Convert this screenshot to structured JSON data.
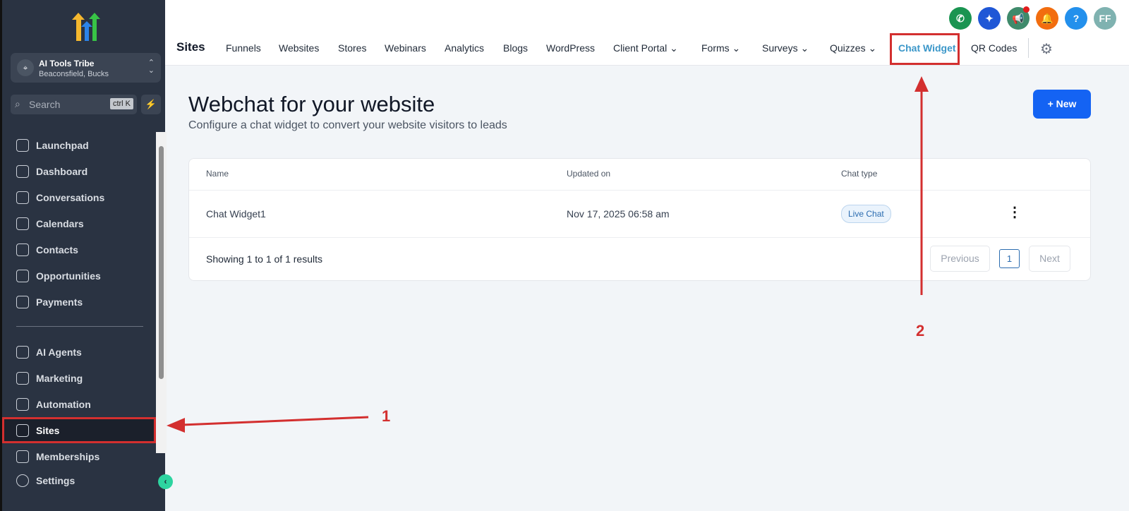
{
  "account": {
    "name": "AI Tools Tribe",
    "location": "Beaconsfield, Bucks"
  },
  "search": {
    "placeholder": "Search",
    "shortcut": "ctrl K"
  },
  "sidebar": {
    "items": [
      {
        "label": "Launchpad",
        "icon": "rocket-icon"
      },
      {
        "label": "Dashboard",
        "icon": "grid-icon"
      },
      {
        "label": "Conversations",
        "icon": "chat-icon"
      },
      {
        "label": "Calendars",
        "icon": "calendar-icon"
      },
      {
        "label": "Contacts",
        "icon": "contacts-icon"
      },
      {
        "label": "Opportunities",
        "icon": "opportunities-icon"
      },
      {
        "label": "Payments",
        "icon": "payments-icon"
      }
    ],
    "items2": [
      {
        "label": "AI Agents",
        "icon": "sparkle-icon"
      },
      {
        "label": "Marketing",
        "icon": "send-icon"
      },
      {
        "label": "Automation",
        "icon": "automation-icon"
      },
      {
        "label": "Sites",
        "icon": "sites-icon",
        "active": true
      },
      {
        "label": "Memberships",
        "icon": "memberships-icon"
      }
    ],
    "settings": "Settings"
  },
  "header": {
    "title": "Sites",
    "tabs": [
      "Funnels",
      "Websites",
      "Stores",
      "Webinars",
      "Analytics",
      "Blogs",
      "WordPress",
      "Client Portal ⌄",
      "Forms ⌄",
      "Surveys ⌄",
      "Quizzes ⌄",
      "Chat Widget",
      "QR Codes"
    ],
    "active_tab": "Chat Widget",
    "icons": [
      {
        "name": "phone-icon",
        "glyph": "✆",
        "color": "#1a9451"
      },
      {
        "name": "ai-sparkle-icon",
        "glyph": "✦",
        "color": "#1f57d6"
      },
      {
        "name": "megaphone-icon",
        "glyph": "📢",
        "color": "#3f8a6b"
      },
      {
        "name": "bell-icon",
        "glyph": "🔔",
        "color": "#f26d0f"
      },
      {
        "name": "help-icon",
        "glyph": "?",
        "color": "#2390ec"
      },
      {
        "name": "avatar",
        "glyph": "FF",
        "color": "#7fb2b0"
      }
    ]
  },
  "main": {
    "title": "Webchat for your website",
    "subtitle": "Configure a chat widget to convert your website visitors to leads",
    "new_button": "+  New",
    "columns": [
      "Name",
      "Updated on",
      "Chat type"
    ],
    "rows": [
      {
        "name": "Chat Widget1",
        "updated": "Nov 17, 2025 06:58 am",
        "type": "Live Chat"
      }
    ],
    "showing": "Showing 1 to 1 of 1 results",
    "previous": "Previous",
    "page": "1",
    "next": "Next"
  },
  "annotations": {
    "one": "1",
    "two": "2",
    "color": "#d32f2f"
  }
}
